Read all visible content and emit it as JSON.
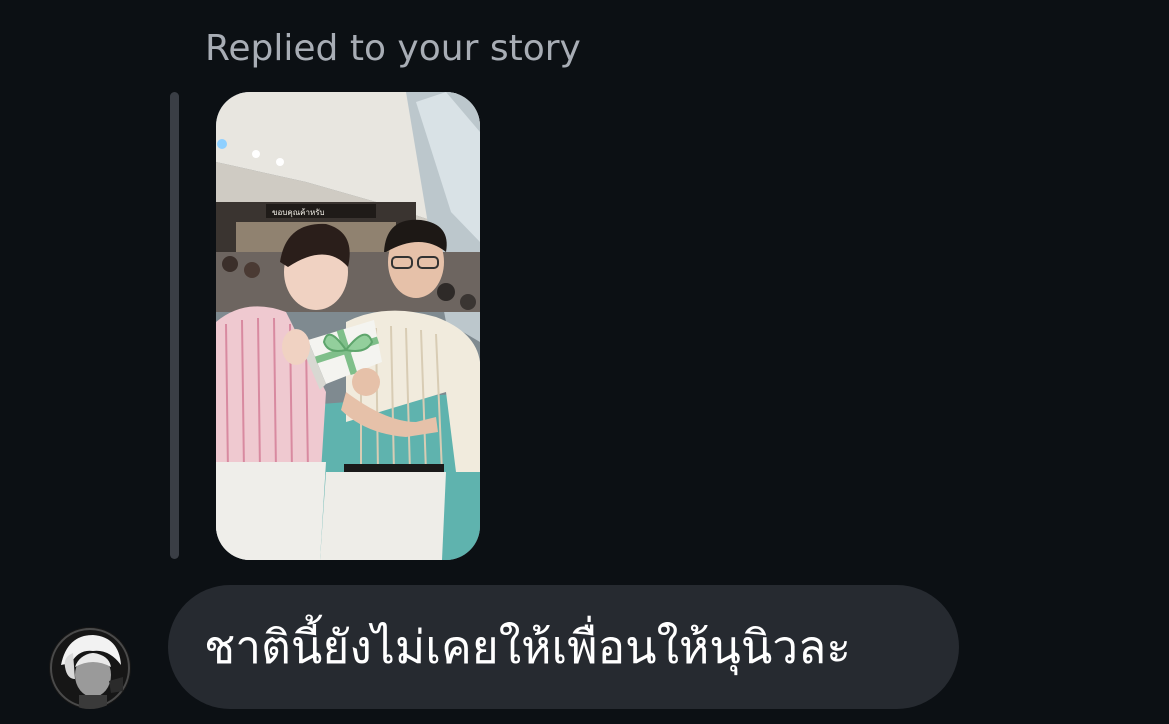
{
  "reply": {
    "label": "Replied to your story"
  },
  "story": {
    "description_icon": "story-photo",
    "sign_text": "ขอบคุณค้าหรับ"
  },
  "message": {
    "text": "ชาตินี้ยังไม่เคยให้เพื่อนให้นุนิวละ",
    "sender_avatar": "avatar-image"
  },
  "colors": {
    "background": "#0c1014",
    "bubble": "#262a30",
    "label": "#a8adb5",
    "reply_bar": "#3a3e45"
  }
}
